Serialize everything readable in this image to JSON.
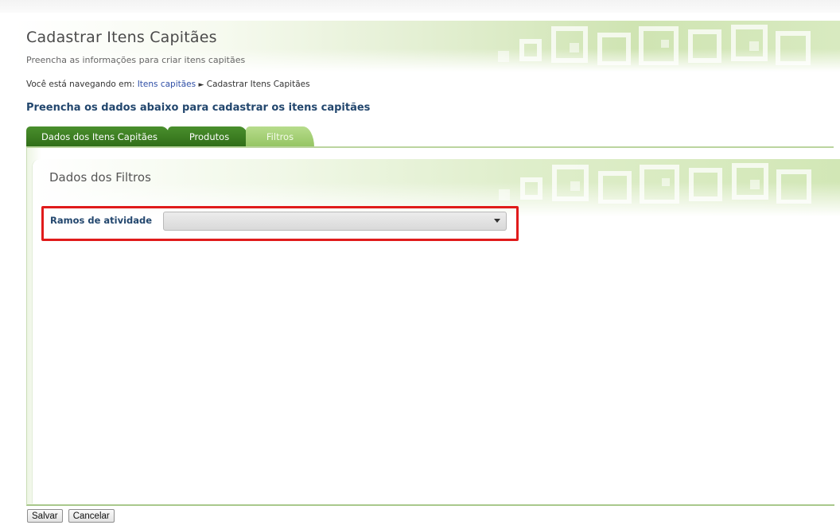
{
  "page": {
    "title": "Cadastrar Itens Capitães",
    "subtitle": "Preencha as informações para criar itens capitães"
  },
  "breadcrumb": {
    "prefix": "Você está navegando em:",
    "link": "Itens capitães",
    "separator": "►",
    "current": "Cadastrar Itens Capitães"
  },
  "section_heading": "Preencha os dados abaixo para cadastrar os itens capitães",
  "tabs": [
    {
      "label": "Dados dos Itens Capitães",
      "active": false
    },
    {
      "label": "Produtos",
      "active": false
    },
    {
      "label": "Filtros",
      "active": true
    }
  ],
  "panel": {
    "title": "Dados dos Filtros"
  },
  "form": {
    "ramos_label": "Ramos de atividade",
    "ramos_value": ""
  },
  "buttons": {
    "save": "Salvar",
    "cancel": "Cancelar"
  },
  "colors": {
    "tab_inactive": "#3c7d22",
    "tab_active": "#a6d07a",
    "heading": "#23476e",
    "highlight": "#e01b1b",
    "link": "#2e4ea6"
  }
}
